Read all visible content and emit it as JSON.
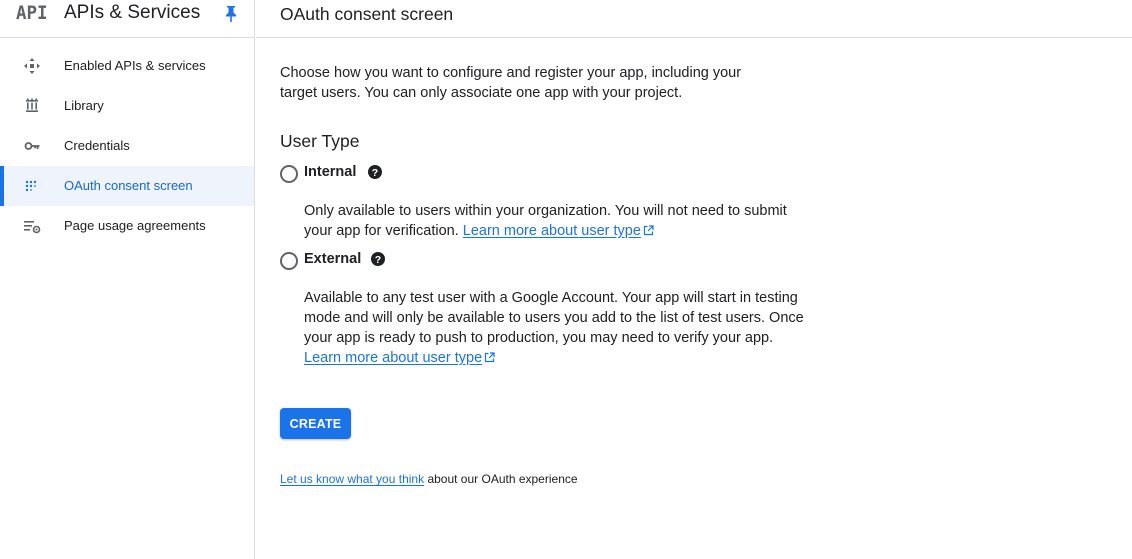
{
  "sidebar": {
    "logo": "API",
    "title": "APIs & Services",
    "pin_icon": "pin-icon",
    "items": [
      {
        "label": "Enabled APIs & services",
        "icon": "apis-icon",
        "active": false
      },
      {
        "label": "Library",
        "icon": "library-icon",
        "active": false
      },
      {
        "label": "Credentials",
        "icon": "key-icon",
        "active": false
      },
      {
        "label": "OAuth consent screen",
        "icon": "consent-icon",
        "active": true
      },
      {
        "label": "Page usage agreements",
        "icon": "settings-list-icon",
        "active": false
      }
    ]
  },
  "main": {
    "title": "OAuth consent screen",
    "intro": "Choose how you want to configure and register your app, including your target users. You can only associate one app with your project.",
    "user_type_heading": "User Type",
    "options": [
      {
        "label": "Internal",
        "selected": false,
        "description": "Only available to users within your organization. You will not need to submit your app for verification.",
        "link": "Learn more about user type"
      },
      {
        "label": "External",
        "selected": false,
        "description": "Available to any test user with a Google Account. Your app will start in testing mode and will only be available to users you add to the list of test users. Once your app is ready to push to production, you may need to verify your app.",
        "link": "Learn more about user type"
      }
    ],
    "create_button": "CREATE",
    "feedback_link": "Let us know what you think",
    "feedback_text": "about our OAuth experience"
  },
  "colors": {
    "accent": "#1a73e8",
    "active_bg": "#eef3fc",
    "text": "#202124",
    "icon": "#5f6368",
    "divider": "#dadce0"
  }
}
